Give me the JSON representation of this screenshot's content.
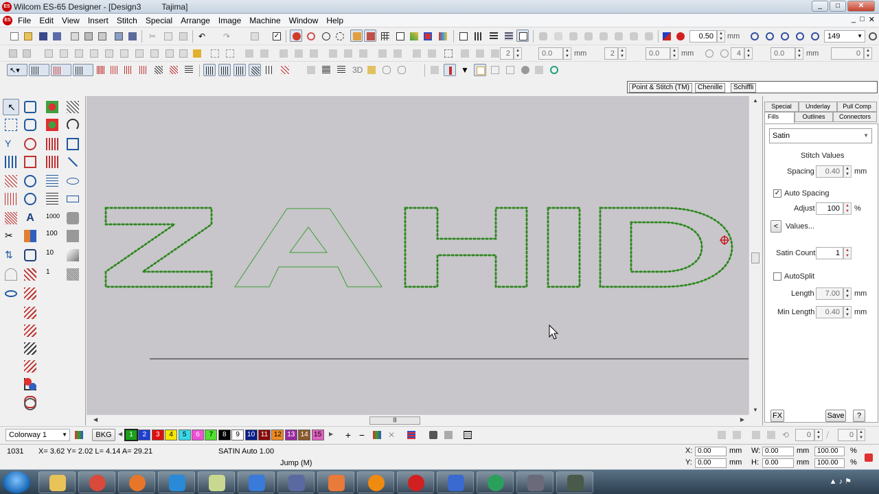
{
  "window": {
    "app_icon": "ES",
    "title": "Wilcom ES-65 Designer - [Design3",
    "title_suffix": "Tajima]",
    "buttons": [
      "_",
      "□",
      "✕"
    ]
  },
  "menu": {
    "doc_icon": "ES",
    "items": [
      "File",
      "Edit",
      "View",
      "Insert",
      "Stitch",
      "Special",
      "Arrange",
      "Image",
      "Machine",
      "Window",
      "Help"
    ],
    "mdi_buttons": [
      "_",
      "□",
      "✕"
    ]
  },
  "toolbar": {
    "pen_width": "0.50",
    "pen_unit": "mm",
    "zoom": "149",
    "row2_fields": [
      "2",
      "0.0",
      "mm",
      "2",
      "0.0",
      "mm",
      "4",
      "0.0",
      "mm",
      "0"
    ],
    "row3_3d_label": "3D"
  },
  "object_tabs": [
    "Point & Stitch (TM)",
    "Chenille",
    "Schiffli"
  ],
  "left_tool_numbers": [
    "1000",
    "100",
    "10",
    "1"
  ],
  "left_tool_letter": "A",
  "canvas": {
    "design_text": [
      "Z",
      "A",
      "H",
      "I",
      "D"
    ],
    "colors": {
      "background": "#c8c5cb",
      "stitch_green": "#3e9e2a",
      "outline_green": "#37a02e"
    }
  },
  "panel": {
    "tabs_top": [
      "Special",
      "Underlay",
      "Pull Comp"
    ],
    "tabs_bottom": [
      "Fills",
      "Outlines",
      "Connectors"
    ],
    "fill_type": "Satin",
    "stitch_values_heading": "Stitch Values",
    "spacing_label": "Spacing",
    "spacing_value": "0.40",
    "spacing_unit": "mm",
    "auto_spacing_label": "Auto Spacing",
    "auto_spacing_checked": true,
    "adjust_label": "Adjust",
    "adjust_value": "100",
    "adjust_unit": "%",
    "values_button": "Values...",
    "satin_count_label": "Satin Count",
    "satin_count_value": "1",
    "autosplit_label": "AutoSplit",
    "autosplit_checked": false,
    "length_label": "Length",
    "length_value": "7.00",
    "length_unit": "mm",
    "min_length_label": "Min Length",
    "min_length_value": "0.40",
    "min_length_unit": "mm",
    "fx_button": "FX",
    "save_button": "Save",
    "help_button": "?"
  },
  "colorbar": {
    "colorway": "Colorway 1",
    "bkg_button": "BKG",
    "swatches": [
      {
        "n": "1",
        "color": "#1aa01a",
        "text": "#fff"
      },
      {
        "n": "2",
        "color": "#1f3fd0",
        "text": "#fff"
      },
      {
        "n": "3",
        "color": "#e01010",
        "text": "#fff"
      },
      {
        "n": "4",
        "color": "#f2e600",
        "text": "#000"
      },
      {
        "n": "5",
        "color": "#38d8e8",
        "text": "#000"
      },
      {
        "n": "6",
        "color": "#f050d8",
        "text": "#fff"
      },
      {
        "n": "7",
        "color": "#50e030",
        "text": "#000"
      },
      {
        "n": "8",
        "color": "#000000",
        "text": "#fff"
      },
      {
        "n": "9",
        "color": "#ffffff",
        "text": "#000"
      },
      {
        "n": "10",
        "color": "#0a1f8a",
        "text": "#fff"
      },
      {
        "n": "11",
        "color": "#8a0a0a",
        "text": "#fff"
      },
      {
        "n": "12",
        "color": "#f08a20",
        "text": "#000"
      },
      {
        "n": "13",
        "color": "#9a2aa0",
        "text": "#fff"
      },
      {
        "n": "14",
        "color": "#8a5a2a",
        "text": "#fff"
      },
      {
        "n": "15",
        "color": "#e060c0",
        "text": "#000"
      }
    ],
    "right_fields": [
      "0",
      "0"
    ]
  },
  "status": {
    "stitch_count": "1031",
    "coords": "X=  3.62 Y=  2.02 L=  4.14 A=  29.21",
    "object_info": "SATIN Auto  1.00",
    "jump": "Jump (M)",
    "x_label": "X:",
    "x_value": "0.00",
    "x_unit": "mm",
    "y_label": "Y:",
    "y_value": "0.00",
    "y_unit": "mm",
    "w_label": "W:",
    "w_value": "0.00",
    "w_unit": "mm",
    "h_label": "H:",
    "h_value": "0.00",
    "h_unit": "mm",
    "w_pct": "100.00",
    "h_pct": "100.00",
    "pct_unit": "%"
  },
  "taskbar": {
    "apps": [
      "explorer",
      "chrome",
      "firefox",
      "internet-explorer",
      "notes",
      "outlook",
      "media",
      "powerpoint",
      "vlc",
      "wilcom",
      "word",
      "network",
      "itunes",
      "tool"
    ],
    "app_colors": [
      "#e8c35a",
      "#d94a3a",
      "#e8762a",
      "#2a8ad8",
      "#c8d890",
      "#3a7ad8",
      "#5a6aa0",
      "#e87a3a",
      "#f08a10",
      "#d02020",
      "#3a6ad0",
      "#2aa05a",
      "#6a6a7a",
      "#4a5a4a"
    ]
  }
}
